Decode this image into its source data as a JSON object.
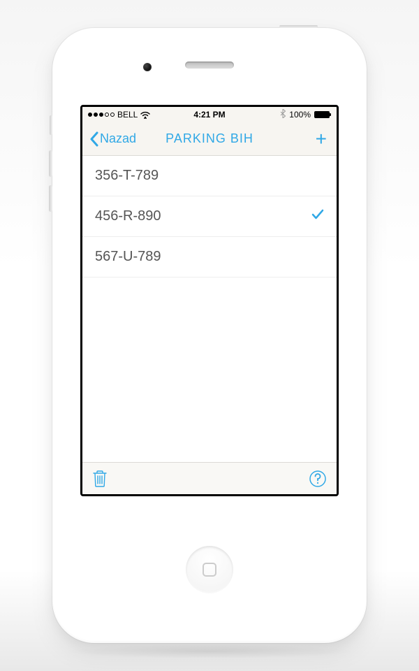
{
  "status_bar": {
    "carrier": "BELL",
    "time": "4:21 PM",
    "battery_pct": "100%"
  },
  "nav": {
    "back_label": "Nazad",
    "title": "PARKING BIH",
    "add_label": "+"
  },
  "list": {
    "items": [
      {
        "label": "356-T-789",
        "selected": false
      },
      {
        "label": "456-R-890",
        "selected": true
      },
      {
        "label": "567-U-789",
        "selected": false
      }
    ]
  },
  "colors": {
    "accent": "#30a8e6"
  }
}
